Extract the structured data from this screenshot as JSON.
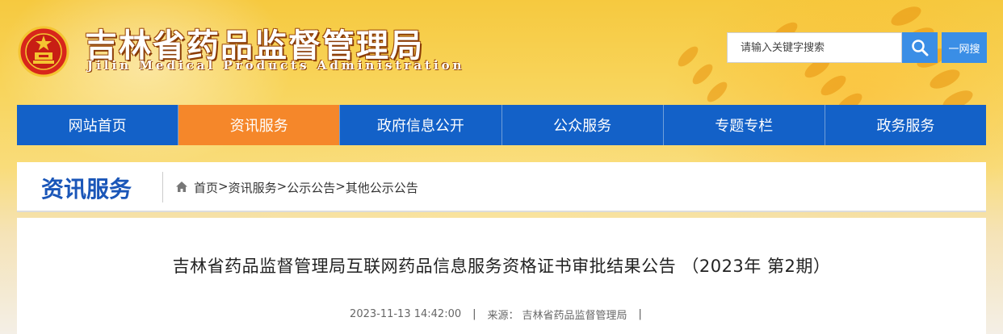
{
  "header": {
    "title": "吉林省药品监督管理局",
    "subtitle": "Jilin Medical Products Administration",
    "search": {
      "placeholder": "请输入关键字搜索",
      "button_icon": "search-icon",
      "yiwang_label": "一网搜"
    }
  },
  "nav": {
    "items": [
      {
        "label": "网站首页"
      },
      {
        "label": "资讯服务",
        "active": true
      },
      {
        "label": "政府信息公开"
      },
      {
        "label": "公众服务"
      },
      {
        "label": "专题专栏"
      },
      {
        "label": "政务服务"
      }
    ]
  },
  "breadcrumb": {
    "section_title": "资讯服务",
    "items": [
      "首页",
      "资讯服务",
      "公示公告",
      "其他公示公告"
    ],
    "separator": ">"
  },
  "article": {
    "title": "吉林省药品监督管理局互联网药品信息服务资格证书审批结果公告 （2023年 第2期）",
    "date": "2023-11-13 14:42:00",
    "source_label": "来源：",
    "source": "吉林省药品监督管理局",
    "divider": "|"
  },
  "colors": {
    "nav_bg": "#1361c8",
    "nav_active": "#f5872a",
    "search_btn": "#3a8ee6",
    "section_title": "#1a56b8"
  }
}
